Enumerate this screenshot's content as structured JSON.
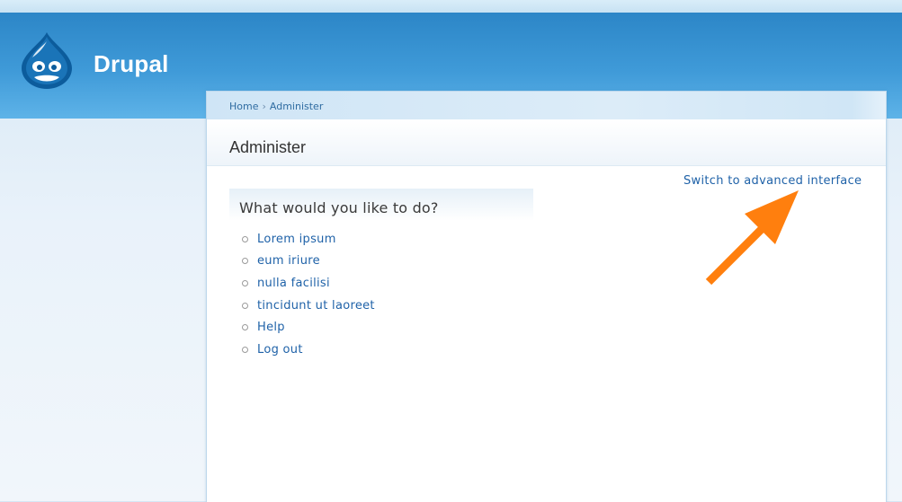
{
  "site": {
    "name": "Drupal",
    "logo_icon": "drupal-drop-logo"
  },
  "breadcrumb": {
    "home": "Home",
    "separator": "›",
    "current": "Administer"
  },
  "page": {
    "title": "Administer"
  },
  "switch_link": {
    "label": "Switch to advanced interface"
  },
  "panel": {
    "title": "What would you like to do?",
    "items": [
      {
        "label": "Lorem ipsum"
      },
      {
        "label": "eum iriure"
      },
      {
        "label": "nulla facilisi"
      },
      {
        "label": "tincidunt ut laoreet"
      },
      {
        "label": "Help"
      },
      {
        "label": "Log out"
      }
    ]
  },
  "annotation": {
    "icon": "arrow-icon",
    "color": "#ff7f0e"
  },
  "colors": {
    "header_blue": "#2c86c7",
    "link": "#1f62a8",
    "accent_orange": "#ff7f0e"
  }
}
